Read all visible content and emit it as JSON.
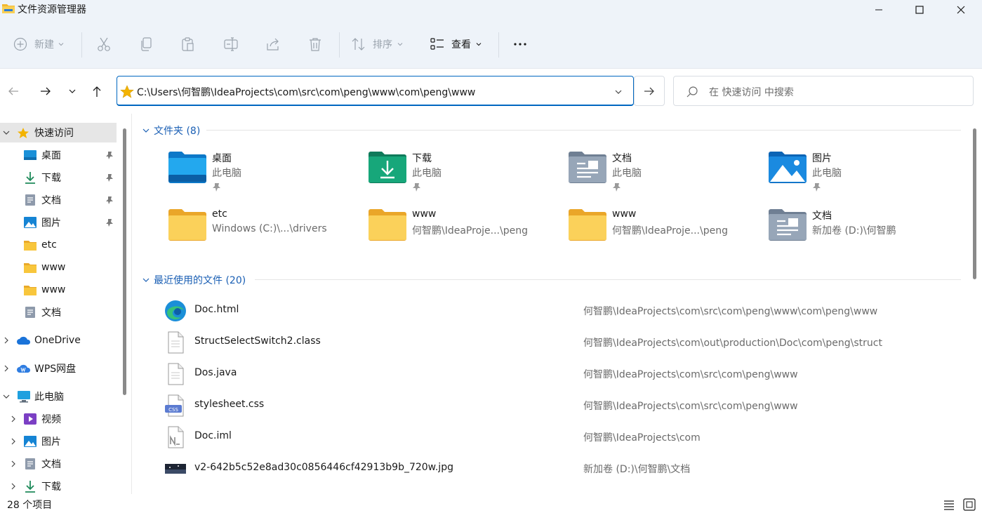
{
  "window": {
    "title": "文件资源管理器"
  },
  "toolbar": {
    "new_label": "新建",
    "sort_label": "排序",
    "view_label": "查看"
  },
  "address": {
    "path": "C:\\Users\\何智鹏\\IdeaProjects\\com\\src\\com\\peng\\www\\com\\peng\\www"
  },
  "search": {
    "placeholder": "在 快速访问 中搜索"
  },
  "sidebar": {
    "quick_access": "快速访问",
    "quick_items": [
      "桌面",
      "下载",
      "文档",
      "图片",
      "etc",
      "www",
      "www",
      "文档"
    ],
    "onedrive": "OneDrive",
    "wps": "WPS网盘",
    "this_pc": "此电脑",
    "pc_items": [
      "视频",
      "图片",
      "文档",
      "下载"
    ]
  },
  "folders_group": {
    "title": "文件夹 (8)"
  },
  "folders": [
    {
      "name": "桌面",
      "sub": "此电脑",
      "icon": "desktop-folder-icon",
      "pinned": true
    },
    {
      "name": "下载",
      "sub": "此电脑",
      "icon": "download-folder-icon",
      "pinned": true
    },
    {
      "name": "文档",
      "sub": "此电脑",
      "icon": "documents-folder-icon",
      "pinned": true
    },
    {
      "name": "图片",
      "sub": "此电脑",
      "icon": "pictures-folder-icon",
      "pinned": true
    },
    {
      "name": "etc",
      "sub": "Windows  (C:)\\...\\drivers",
      "icon": "folder-icon",
      "pinned": false
    },
    {
      "name": "www",
      "sub": "何智鹏\\IdeaProje...\\peng",
      "icon": "folder-icon",
      "pinned": false
    },
    {
      "name": "www",
      "sub": "何智鹏\\IdeaProje...\\peng",
      "icon": "folder-icon",
      "pinned": false
    },
    {
      "name": "文档",
      "sub": "新加卷 (D:)\\何智鹏",
      "icon": "documents-folder-icon",
      "pinned": false
    }
  ],
  "recent_group": {
    "title": "最近使用的文件 (20)"
  },
  "recent_files": [
    {
      "name": "Doc.html",
      "path": "何智鹏\\IdeaProjects\\com\\src\\com\\peng\\www\\com\\peng\\www",
      "icon": "edge-icon"
    },
    {
      "name": "StructSelectSwitch2.class",
      "path": "何智鹏\\IdeaProjects\\com\\out\\production\\Doc\\com\\peng\\struct",
      "icon": "file-icon"
    },
    {
      "name": "Dos.java",
      "path": "何智鹏\\IdeaProjects\\com\\src\\com\\peng\\www",
      "icon": "file-icon"
    },
    {
      "name": "stylesheet.css",
      "path": "何智鹏\\IdeaProjects\\com\\src\\com\\peng\\www",
      "icon": "css-file-icon"
    },
    {
      "name": "Doc.iml",
      "path": "何智鹏\\IdeaProjects\\com",
      "icon": "iml-file-icon"
    },
    {
      "name": "v2-642b5c52e8ad30c0856446cf42913b9b_720w.jpg",
      "path": "新加卷 (D:)\\何智鹏\\文档",
      "icon": "image-thumbnail-icon"
    }
  ],
  "status": {
    "count": "28 个项目"
  },
  "colors": {
    "accent": "#0067c0",
    "link": "#1a5fb4",
    "folder": "#f8c63c",
    "chrome": "#eef3f9"
  }
}
